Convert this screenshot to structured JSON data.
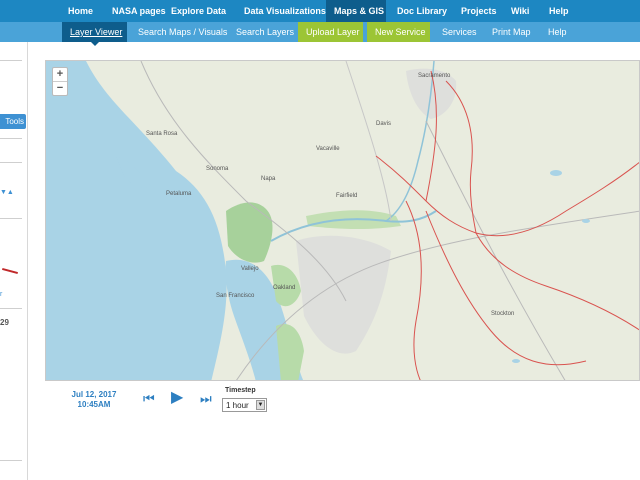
{
  "topnav": {
    "items": [
      "Home",
      "NASA pages",
      "Explore Data",
      "Data Visualizations",
      "Maps & GIS",
      "Doc Library",
      "Projects",
      "Wiki",
      "Help"
    ],
    "active": "Maps & GIS"
  },
  "subnav": {
    "items": [
      "Layer Viewer",
      "Search Maps / Visuals",
      "Search Layers",
      "Upload Layer",
      "New Service",
      "Services",
      "Print Map",
      "Help"
    ],
    "active": "Layer Viewer",
    "highlighted": [
      "Upload Layer",
      "New Service"
    ]
  },
  "leftpanel": {
    "tools_label": "Tools",
    "partial_number": "29"
  },
  "map": {
    "zoom_in": "+",
    "zoom_out": "−",
    "labels": [
      "Sacramento",
      "Vallejo",
      "San Francisco",
      "Oakland",
      "Fairfield",
      "Napa",
      "Petaluma",
      "Stockton",
      "Davis",
      "Vacaville",
      "Santa Rosa",
      "Sonoma"
    ]
  },
  "playback": {
    "date": "Jul 12, 2017",
    "time": "10:45AM",
    "timestep_label": "Timestep",
    "timestep_value": "1 hour"
  },
  "colors": {
    "nav_blue": "#1d87c2",
    "subnav_blue": "#4aa3d8",
    "active_dark": "#0e5d8c",
    "green_highlight": "#9cc535",
    "water": "#a9d3e6",
    "route_red": "#d9534f"
  }
}
